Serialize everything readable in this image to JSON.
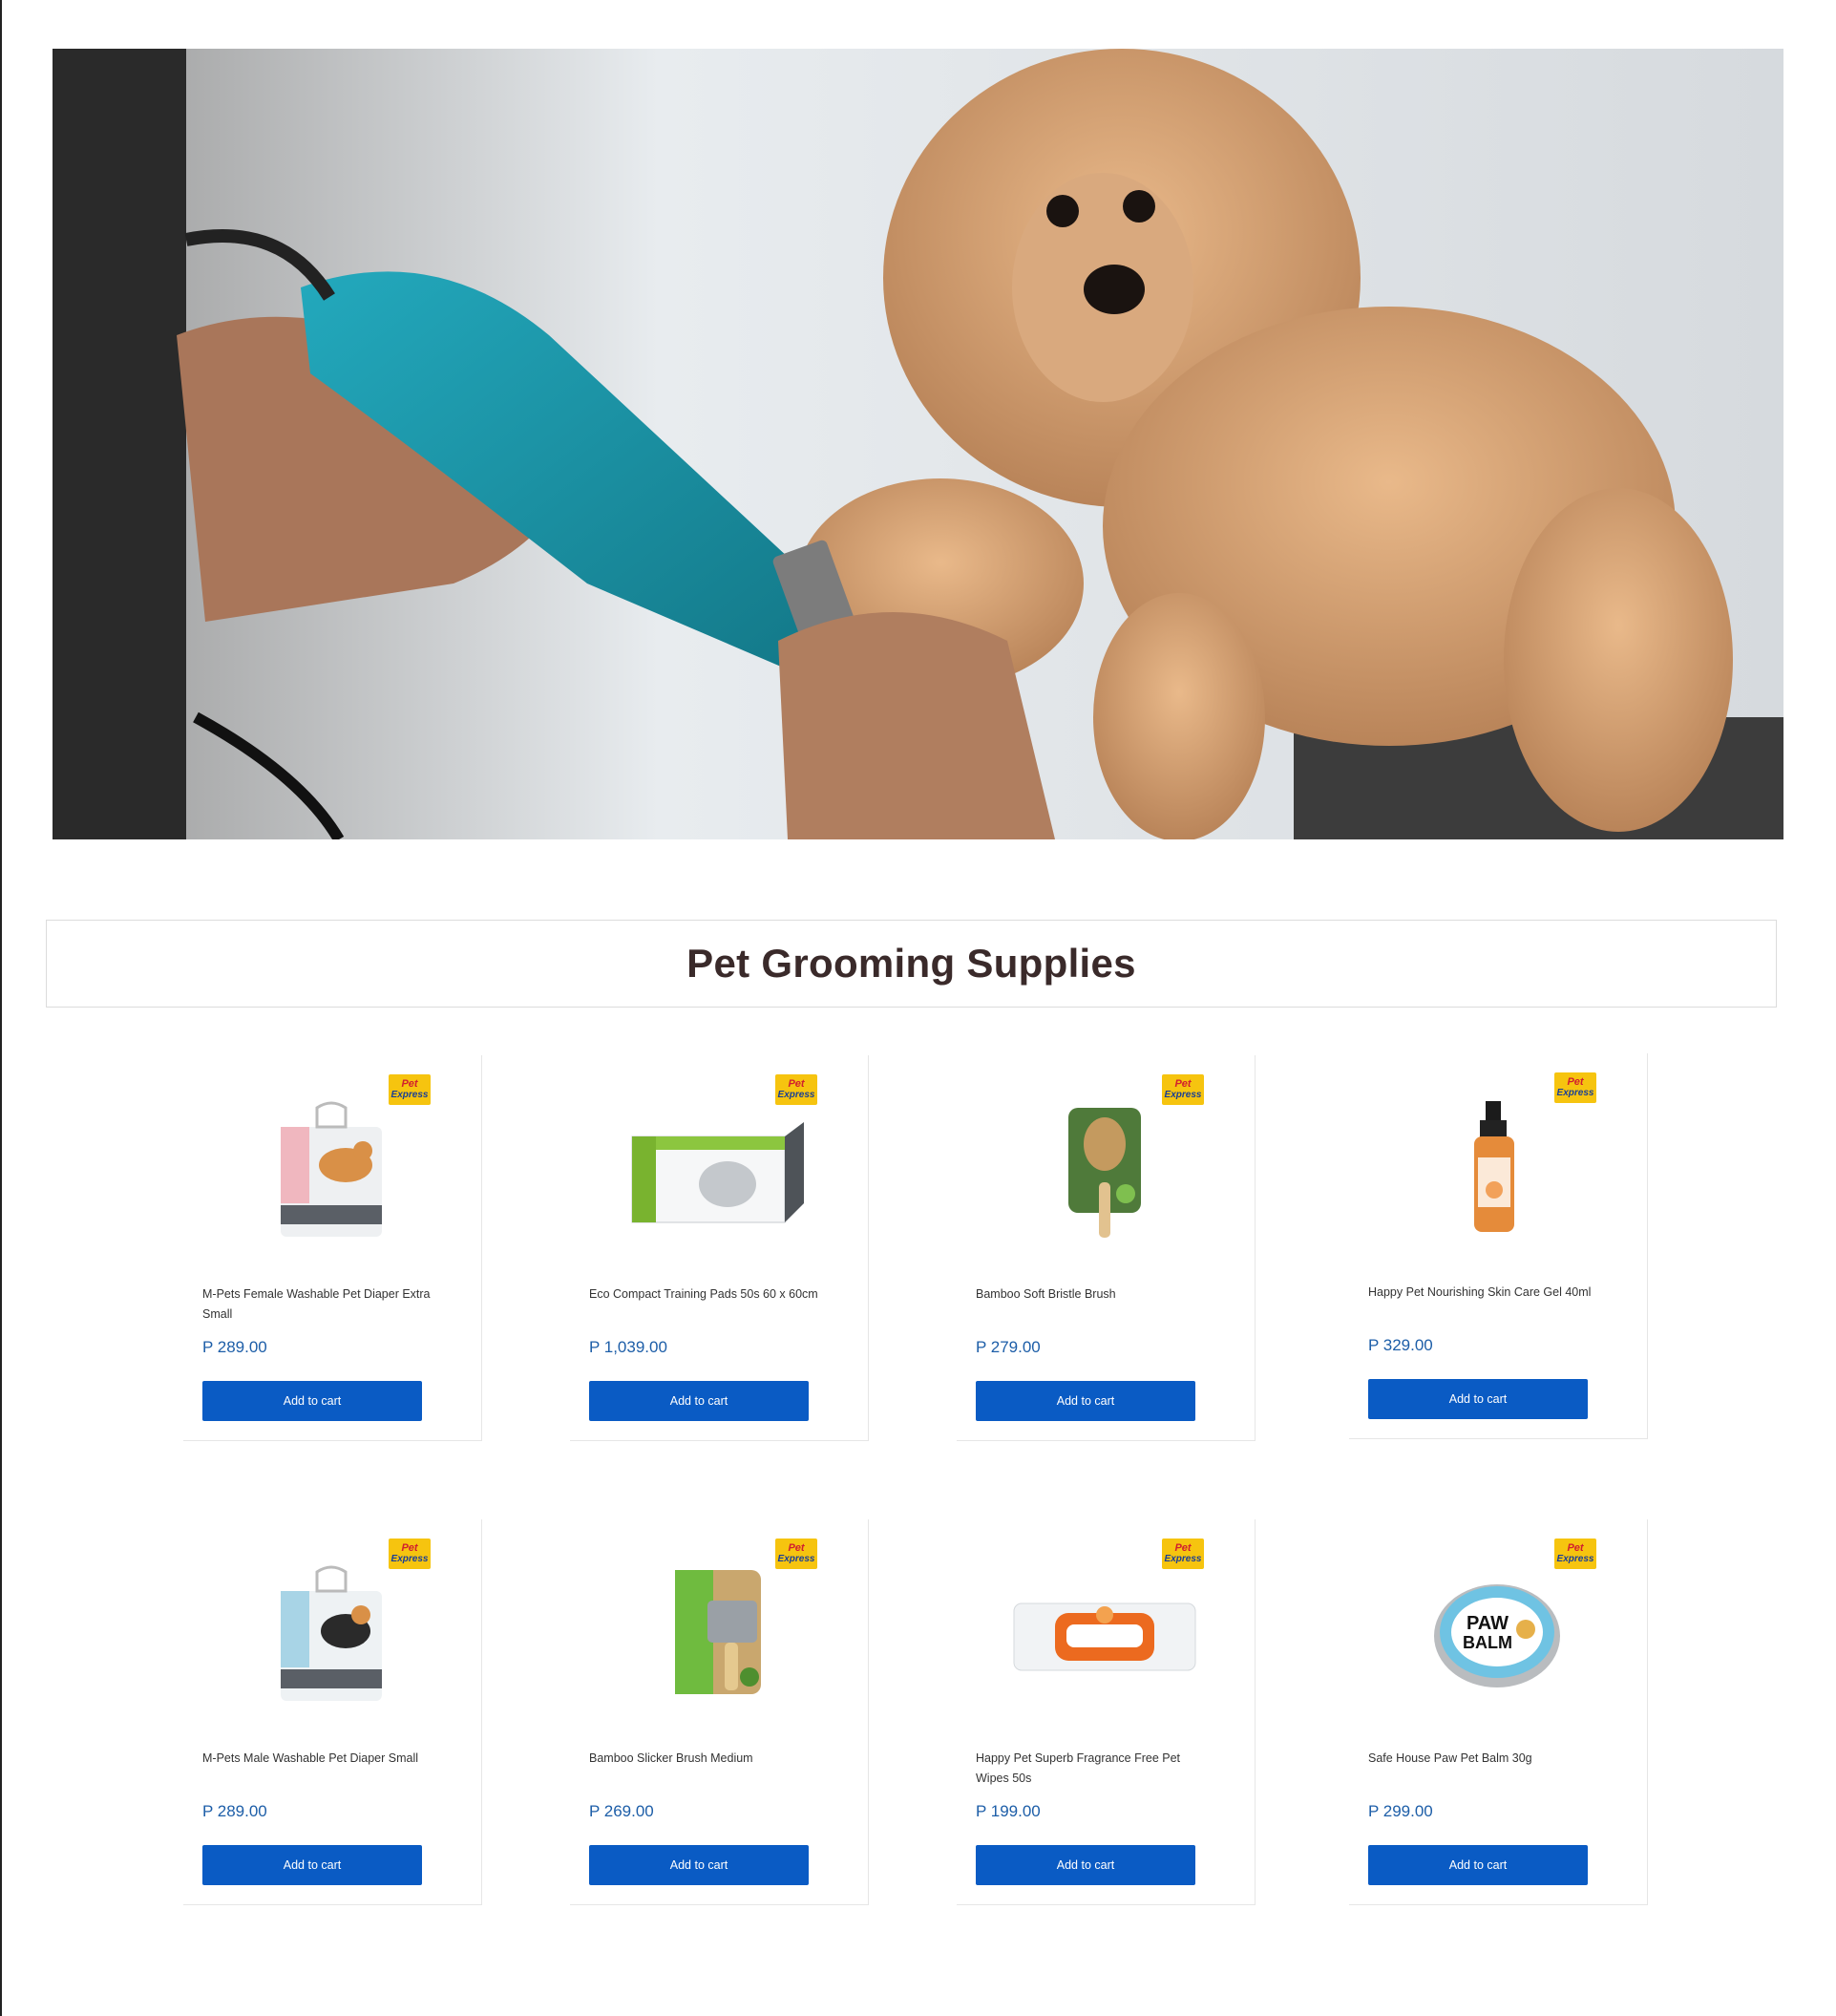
{
  "section": {
    "title": "Pet Grooming Supplies"
  },
  "brand_badge": {
    "line1": "Pet",
    "line2": "Express"
  },
  "colors": {
    "button": "#0a5bc4",
    "price": "#1d5ea8",
    "title": "#3a2a2a",
    "badge": "#f6c40f"
  },
  "products": [
    {
      "name": "M-Pets Female Washable Pet Diaper Extra Small",
      "price": "P 289.00",
      "button": "Add to cart",
      "image": "diaper-pack-pink"
    },
    {
      "name": "Eco Compact Training Pads 50s 60 x 60cm",
      "price": "P 1,039.00",
      "button": "Add to cart",
      "image": "training-pads-box"
    },
    {
      "name": "Bamboo Soft Bristle Brush",
      "price": "P 279.00",
      "button": "Add to cart",
      "image": "bristle-brush"
    },
    {
      "name": "Happy Pet Nourishing Skin Care Gel 40ml",
      "price": "P 329.00",
      "button": "Add to cart",
      "image": "spray-bottle"
    },
    {
      "name": "M-Pets Male Washable Pet Diaper Small",
      "price": "P 289.00",
      "button": "Add to cart",
      "image": "diaper-pack-blue"
    },
    {
      "name": "Bamboo Slicker Brush Medium",
      "price": "P 269.00",
      "button": "Add to cart",
      "image": "slicker-brush"
    },
    {
      "name": "Happy Pet Superb Fragrance Free Pet Wipes 50s",
      "price": "P 199.00",
      "button": "Add to cart",
      "image": "wipes-pack"
    },
    {
      "name": "Safe House Paw Pet Balm 30g",
      "price": "P 299.00",
      "button": "Add to cart",
      "image": "paw-balm-tin",
      "tin_label": [
        "PAW",
        "BALM"
      ]
    }
  ]
}
